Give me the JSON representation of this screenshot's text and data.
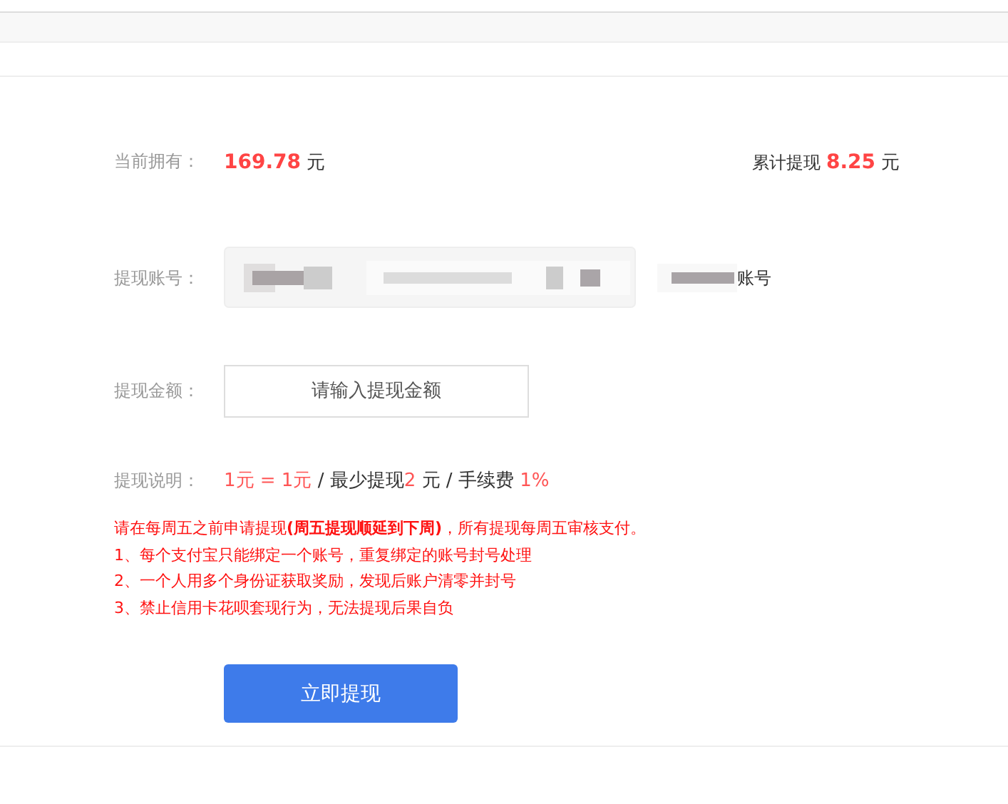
{
  "balance": {
    "label": "当前拥有：",
    "amount": "169.78",
    "unit": "元"
  },
  "total": {
    "label": "累计提现",
    "amount": "8.25",
    "unit": "元"
  },
  "account": {
    "label": "提现账号：",
    "suffix": "账号"
  },
  "amount": {
    "label": "提现金额：",
    "placeholder": "请输入提现金额"
  },
  "rules": {
    "label": "提现说明：",
    "parts": [
      {
        "text": "1元 = 1元",
        "highlight": true
      },
      {
        "text": " / 最少提现",
        "highlight": false
      },
      {
        "text": "2",
        "highlight": true
      },
      {
        "text": " 元 / 手续费 ",
        "highlight": false
      },
      {
        "text": "1%",
        "highlight": true
      }
    ]
  },
  "notes": [
    "请在每周五之前申请提现**(周五提现顺延到下周)**，所有提现每周五审核支付。",
    "1、每个支付宝只能绑定一个账号，重复绑定的账号封号处理",
    "2、一个人用多个身份证获取奖励，发现后账户清零并封号",
    "3、禁止信用卡花呗套现行为，无法提现后果自负"
  ],
  "submit_button": "立即提现"
}
